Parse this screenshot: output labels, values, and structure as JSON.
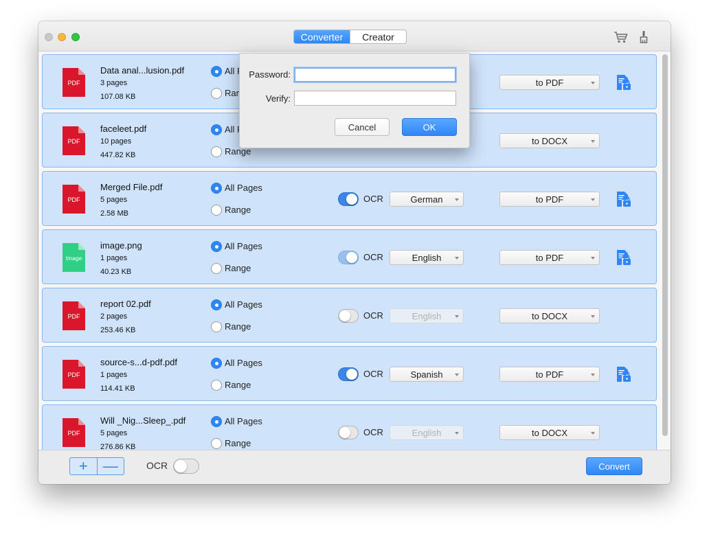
{
  "titlebar": {
    "tabs": [
      {
        "label": "Converter",
        "active": true
      },
      {
        "label": "Creator",
        "active": false
      }
    ],
    "icons": [
      "cart-icon",
      "brush-icon"
    ]
  },
  "files": [
    {
      "name": "Data anal...lusion.pdf",
      "pages": "3 pages",
      "size": "107.08 KB",
      "type": "PDF",
      "mode": "All Pages",
      "range_label": "Range",
      "ocr": null,
      "language": null,
      "target": "to PDF",
      "lock": true
    },
    {
      "name": "faceleet.pdf",
      "pages": "10 pages",
      "size": "447.82 KB",
      "type": "PDF",
      "mode": "All Pages",
      "range_label": "Range",
      "ocr": null,
      "language": null,
      "target": "to DOCX",
      "lock": false
    },
    {
      "name": "Merged File.pdf",
      "pages": "5 pages",
      "size": "2.58 MB",
      "type": "PDF",
      "mode": "All Pages",
      "range_label": "Range",
      "ocr": "on",
      "language": "German",
      "target": "to PDF",
      "lock": true
    },
    {
      "name": "image.png",
      "pages": "1 pages",
      "size": "40.23 KB",
      "type": "Image",
      "mode": "All Pages",
      "range_label": "Range",
      "ocr": "dim",
      "language": "English",
      "target": "to PDF",
      "lock": true
    },
    {
      "name": "report 02.pdf",
      "pages": "2 pages",
      "size": "253.46 KB",
      "type": "PDF",
      "mode": "All Pages",
      "range_label": "Range",
      "ocr": "off",
      "language": "English",
      "language_disabled": true,
      "target": "to DOCX",
      "lock": false
    },
    {
      "name": "source-s...d-pdf.pdf",
      "pages": "1 pages",
      "size": "114.41 KB",
      "type": "PDF",
      "mode": "All Pages",
      "range_label": "Range",
      "ocr": "on",
      "language": "Spanish",
      "target": "to PDF",
      "lock": true
    },
    {
      "name": "Will _Nig...Sleep_.pdf",
      "pages": "5 pages",
      "size": "276.86 KB",
      "type": "PDF",
      "mode": "All Pages",
      "range_label": "Range",
      "ocr": "off",
      "language": "English",
      "language_disabled": true,
      "target": "to DOCX",
      "lock": false
    }
  ],
  "ocr_label": "OCR",
  "bottombar": {
    "add_symbol": "+",
    "remove_symbol": "—",
    "ocr_label": "OCR",
    "convert_label": "Convert"
  },
  "dialog": {
    "password_label": "Password:",
    "verify_label": "Verify:",
    "password_value": "",
    "verify_value": "",
    "cancel_label": "Cancel",
    "ok_label": "OK"
  },
  "colors": {
    "row_bg": "#cfe3fb",
    "row_border": "#8bb6ea",
    "accent": "#2f86f6",
    "pdf_red": "#d9162b",
    "image_green": "#2fcf85"
  }
}
